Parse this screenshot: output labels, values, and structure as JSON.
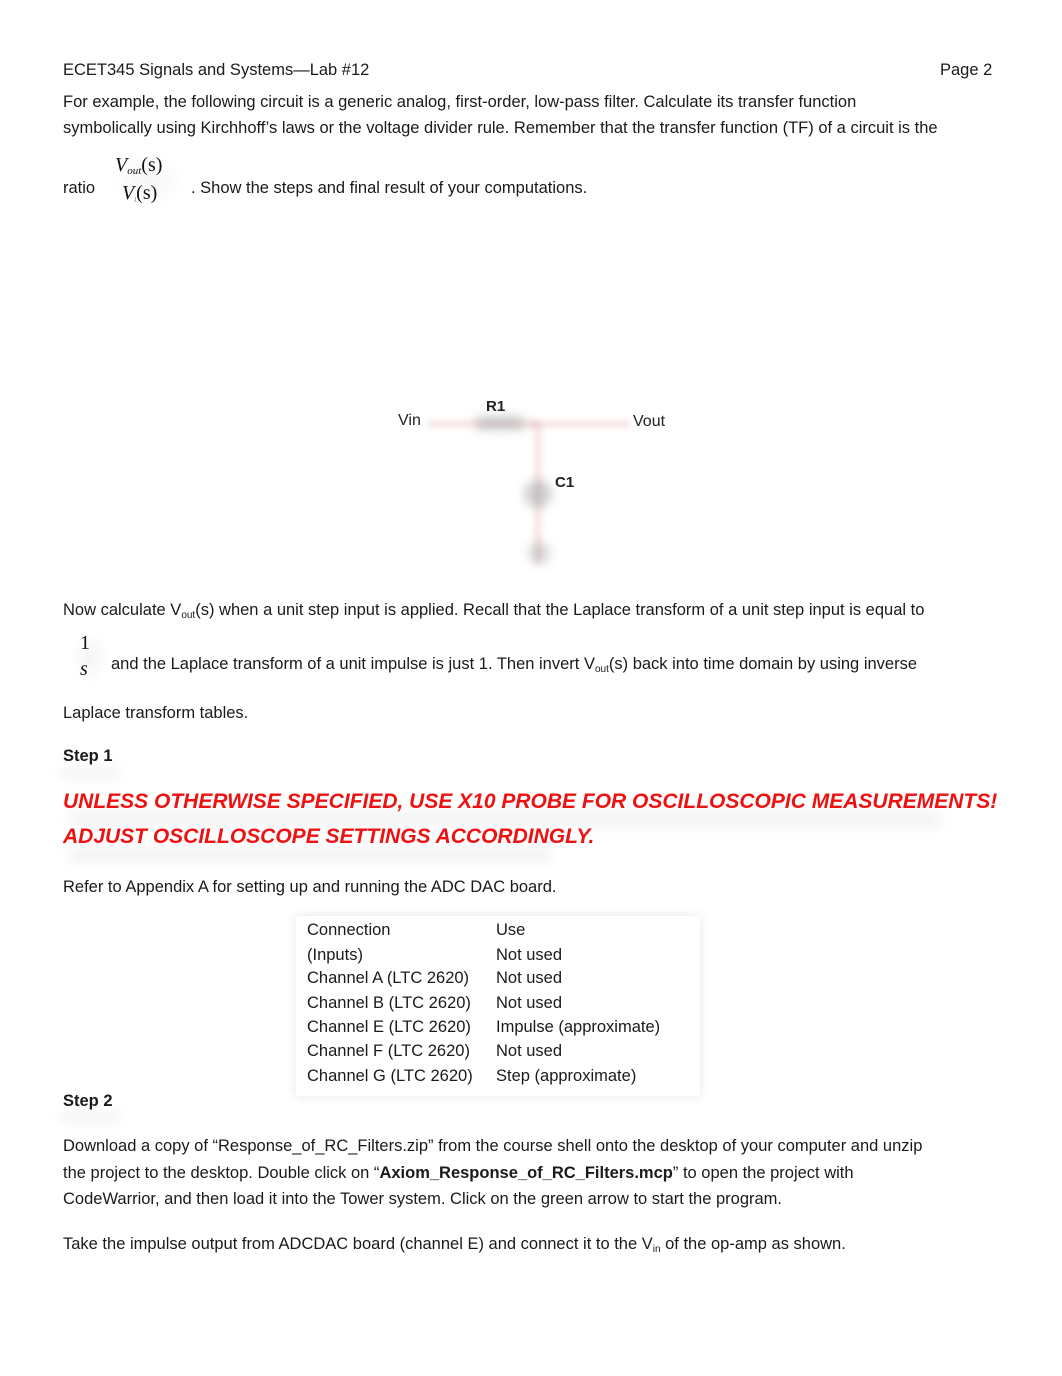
{
  "header": {
    "title": "ECET345 Signals and Systems—Lab #12",
    "page": "Page 2"
  },
  "intro": {
    "line1": "For example, the following circuit is a generic analog, first-order, low-pass filter. Calculate its transfer function",
    "line2": "symbolically using Kirchhoff’s laws or the voltage divider rule. Remember that the transfer function (TF) of a circuit is the",
    "ratio_label": "ratio",
    "ratio_num_var": "V",
    "ratio_num_sub": "out",
    "ratio_num_arg": "(s)",
    "ratio_den_var": "V",
    "ratio_den_sub": "i",
    "ratio_den_arg": "(s)",
    "ratio_rest": ". Show the steps and final result of your computations."
  },
  "circuit": {
    "vin_label": "Vin",
    "vout_label": "Vout",
    "r_label": "R1",
    "c_label": "C1"
  },
  "step_response": {
    "line1_a": "Now calculate V",
    "line1_sub": "out",
    "line1_b": "(s) when a unit step input is applied. Recall that the Laplace transform of a unit step input is equal to",
    "frac_num": "1",
    "frac_den": "s",
    "line2_a": "and the Laplace transform of a unit impulse is just 1. Then invert V",
    "line2_sub": "out",
    "line2_b": "(s) back into time domain by using inverse",
    "line3": "Laplace transform tables."
  },
  "step1": {
    "heading": "Step 1",
    "warning_line1": "UNLESS OTHERWISE SPECIFIED, USE X10 PROBE FOR OSCILLOSCOPIC MEASUREMENTS!",
    "warning_line2": "ADJUST OSCILLOSCOPE SETTINGS ACCORDINGLY.",
    "warning_color": "#ee1111",
    "appendix_text": "Refer to Appendix A for setting up and running the ADC DAC board."
  },
  "connection_table": {
    "headers": [
      "Connection",
      "Use"
    ],
    "rows": [
      [
        "(Inputs)",
        "Not used"
      ],
      [
        "Channel A (LTC 2620)",
        "Not used"
      ],
      [
        "Channel B (LTC 2620)",
        "Not used"
      ],
      [
        "Channel E (LTC 2620)",
        "Impulse (approximate)"
      ],
      [
        "Channel F (LTC 2620)",
        "Not used"
      ],
      [
        "Channel G (LTC 2620)",
        "Step (approximate)"
      ]
    ]
  },
  "step2": {
    "heading": "Step 2",
    "line1": "Download a copy of “Response_of_RC_Filters.zip” from the course shell onto the desktop of your computer and unzip",
    "line2_a": "the project to the desktop. Double click on “",
    "line2_bold": "Axiom_Response_of_RC_Filters.mcp",
    "line2_b": "” to open the project with",
    "line3": "CodeWarrior, and then load it into the Tower system. Click on the green arrow to start the program.",
    "line4_a": "Take the impulse output from ADCDAC board (channel E) and connect it to the V",
    "line4_sub": "in",
    "line4_b": " of the op-amp as shown."
  }
}
